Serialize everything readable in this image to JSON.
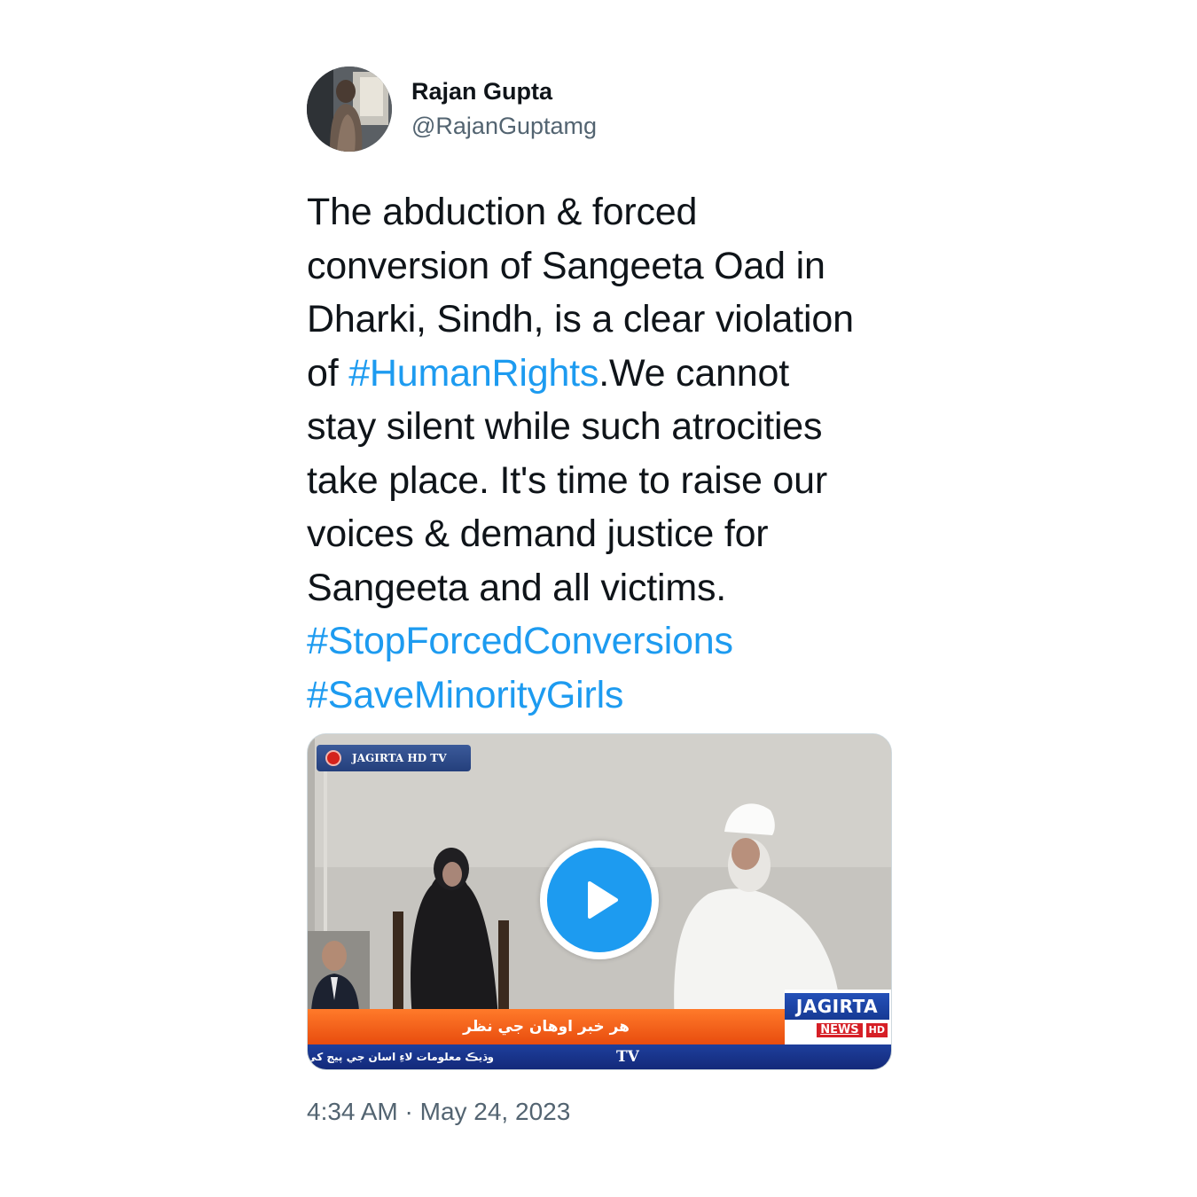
{
  "author": {
    "display_name": "Rajan Gupta",
    "handle": "@RajanGuptamg",
    "avatar_icon": "profile-photo"
  },
  "tweet": {
    "lines": [
      [
        {
          "text": "The abduction & forced"
        }
      ],
      [
        {
          "text": "conversion of Sangeeta Oad in"
        }
      ],
      [
        {
          "text": "Dharki, Sindh, is a clear violation"
        }
      ],
      [
        {
          "text": "of "
        },
        {
          "text": "#HumanRights",
          "hashtag": true
        },
        {
          "text": ".We cannot"
        }
      ],
      [
        {
          "text": "stay silent while such atrocities"
        }
      ],
      [
        {
          "text": "take place. It's time to raise our"
        }
      ],
      [
        {
          "text": "voices & demand justice for"
        }
      ],
      [
        {
          "text": "Sangeeta and all victims."
        }
      ],
      [
        {
          "text": "#StopForcedConversions",
          "hashtag": true
        }
      ],
      [
        {
          "text": "#SaveMinorityGirls",
          "hashtag": true
        }
      ]
    ],
    "timestamp": "4:34 AM · May 24, 2023"
  },
  "video": {
    "channel_badge": "JAGIRTA HD TV",
    "ticker_main": "هر خبر اوهان جي نظر",
    "ticker_bottom": "وڌيڪ معلومات لاءِ اسان جي پيج کي",
    "ticker_tv": "TV",
    "logo_name": "JAGIRTA",
    "logo_news": "NEWS",
    "logo_hd": "HD",
    "play_icon": "play-icon"
  },
  "colors": {
    "hashtag": "#1d9bf0",
    "text": "#0f1419",
    "secondary": "#536471",
    "play": "#1d9bf0"
  }
}
